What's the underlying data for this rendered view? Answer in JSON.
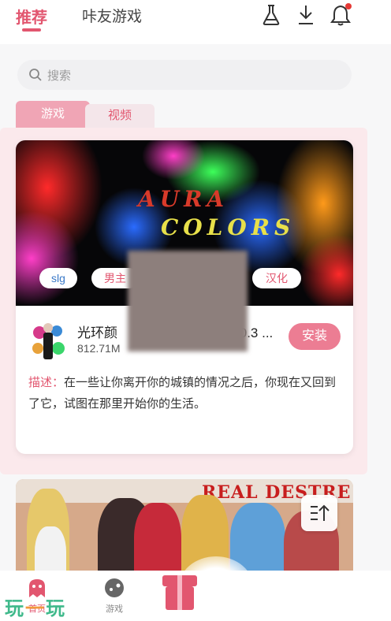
{
  "header": {
    "tab_recommend": "推荐",
    "tab_friends": "咔友游戏",
    "icons": [
      "beaker-icon",
      "download-icon",
      "bell-icon"
    ]
  },
  "search": {
    "placeholder": "搜索"
  },
  "segments": {
    "game": "游戏",
    "video": "视频"
  },
  "card": {
    "banner_line1": "AURA",
    "banner_line2": "COLORS",
    "tags": [
      "slg",
      "男主",
      "汉化"
    ],
    "app_name": "光环颜",
    "version_fragment": "0.3 ...",
    "size": "812.71M",
    "install_label": "安装",
    "desc_label": "描述：",
    "desc_text": "在一些让你离开你的城镇的情况之后，你现在又回到了它，试图在那里开始你的生活。"
  },
  "card2": {
    "banner_title": "REAL DESTRE"
  },
  "bottom_nav": {
    "home_label": "首页",
    "games_label": "游戏"
  },
  "watermark": {
    "left": "玩",
    "mid": "一",
    "right": "玩"
  },
  "colors": {
    "accent": "#e2566f",
    "install": "#ec7d93",
    "slg": "#3a79c8"
  }
}
